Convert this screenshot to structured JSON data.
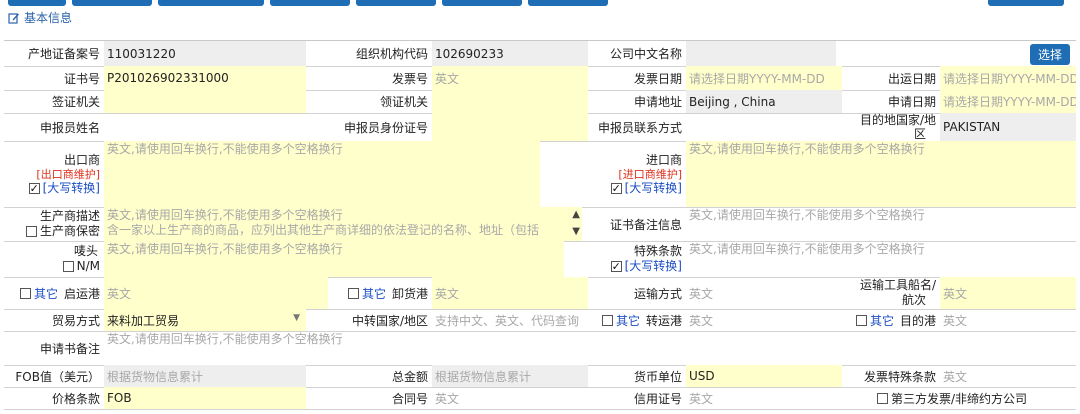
{
  "section": {
    "title": "基本信息"
  },
  "select_button": "选择",
  "rows": {
    "r1": {
      "l1": "产地证备案号",
      "v1": "110031220",
      "l2": "组织机构代码",
      "v2": "102690233",
      "l3": "公司中文名称",
      "v3": ""
    },
    "r2": {
      "l1": "证书号",
      "v1": "P201026902331000",
      "l2": "发票号",
      "v2": "英文",
      "l3": "发票日期",
      "v3": "请选择日期YYYY-MM-DD",
      "l4": "出运日期",
      "v4": "请选择日期YYYY-MM-DD"
    },
    "r3": {
      "l1": "签证机关",
      "l2": "领证机关",
      "l3": "申请地址",
      "v3": "Beijing , China",
      "l4": "申请日期",
      "v4": "请选择日期YYYY-MM-DD"
    },
    "r4": {
      "l1": "申报员姓名",
      "l2": "申报员身份证号",
      "l3": "申报员联系方式",
      "l4a": "目的地国家/地",
      "l4b": "区",
      "v4": "PAKISTAN"
    },
    "r5": {
      "l1": "出口商",
      "red1": "[出口商维护]",
      "conv1": "[大写转换]",
      "ph": "英文,请使用回车换行,不能使用多个空格换行",
      "l2": "进口商",
      "red2": "[进口商维护]",
      "conv2": "[大写转换]"
    },
    "r6": {
      "l1a": "生产商描述",
      "l1b": "生产商保密",
      "ph": "英文,请使用回车换行,不能使用多个空格换行",
      "line2": "含一家以上生产商的商品，应列出其他生产商详细的依法登记的名称、地址（包括",
      "l2": "证书备注信息"
    },
    "r7": {
      "l1": "唛头",
      "nm": "N/M",
      "ph": "英文,请使用回车换行,不能使用多个空格换行",
      "l2": "特殊条款",
      "conv": "[大写转换]"
    },
    "r8": {
      "other": "其它",
      "l1": "启运港",
      "v1": "英文",
      "l2": "卸货港",
      "v2": "英文",
      "l3": "运输方式",
      "v3": "英文",
      "l4a": "运输工具船名/",
      "l4b": "航次",
      "v4": "英文"
    },
    "r9": {
      "l1": "贸易方式",
      "v1": "来料加工贸易",
      "l2": "中转国家/地区",
      "v2": "支持中文、英文、代码查询",
      "other": "其它",
      "l3": "转运港",
      "v3": "英文",
      "l4": "目的港",
      "v4": "英文"
    },
    "r10": {
      "l1": "申请书备注",
      "ph": "英文,请使用回车换行,不能使用多个空格换行"
    },
    "r11": {
      "l1": "FOB值（美元）",
      "v1": "根据货物信息累计",
      "l2": "总金额",
      "v2": "根据货物信息累计",
      "l3": "货币单位",
      "v3": "USD",
      "l4": "发票特殊条款",
      "v4": "英文"
    },
    "r12": {
      "l1": "价格条款",
      "v1": "FOB",
      "l2": "合同号",
      "v2": "英文",
      "l3": "信用证号",
      "v3": "英文",
      "l4": "第三方发票/非缔约方公司"
    }
  }
}
